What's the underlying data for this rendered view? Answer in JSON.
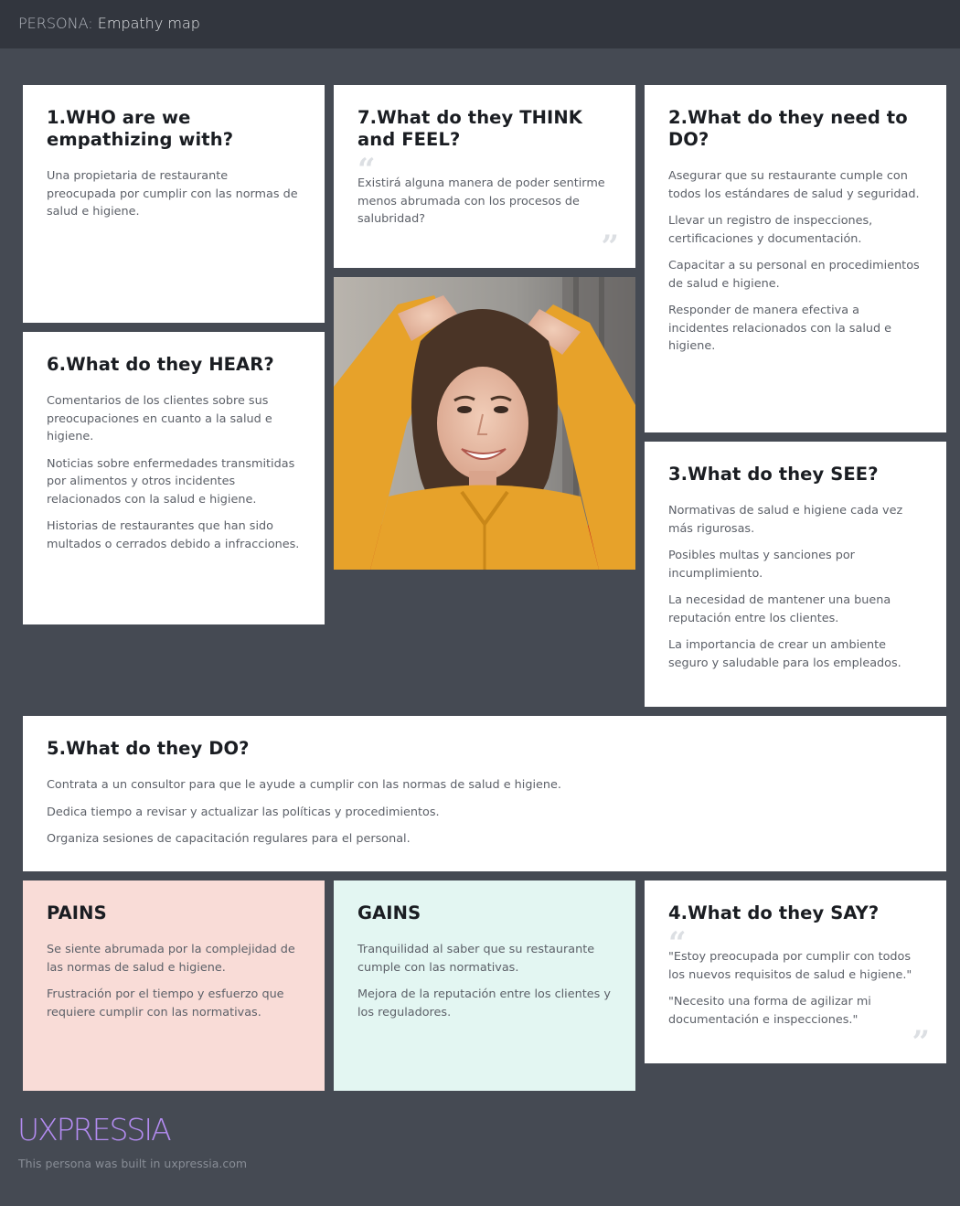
{
  "header": {
    "prefix": "PERSONA:",
    "title": "Empathy map"
  },
  "cards": {
    "who": {
      "title": "1.WHO are we empathizing with?",
      "items": [
        "Una propietaria de restaurante preocupada por cumplir con las normas de salud e higiene."
      ]
    },
    "think_feel": {
      "title": "7.What do they THINK and FEEL?",
      "quotes": [
        "Existirá alguna manera de poder sentirme menos abrumada con los procesos de salubridad?"
      ]
    },
    "need_do": {
      "title": "2.What do they need to DO?",
      "items": [
        "Asegurar que su restaurante cumple con todos los estándares de salud y seguridad.",
        "Llevar un registro de inspecciones, certificaciones y documentación.",
        "Capacitar a su personal en procedimientos de salud e higiene.",
        "Responder de manera efectiva a incidentes relacionados con la salud e higiene."
      ]
    },
    "hear": {
      "title": "6.What do they HEAR?",
      "items": [
        "Comentarios de los clientes sobre sus preocupaciones en cuanto a la salud e higiene.",
        "Noticias sobre enfermedades transmitidas por alimentos y otros incidentes relacionados con la salud e higiene.",
        "Historias de restaurantes que han sido multados o cerrados debido a infracciones."
      ]
    },
    "see": {
      "title": "3.What do they SEE?",
      "items": [
        "Normativas de salud e higiene cada vez más rigurosas.",
        "Posibles multas y sanciones por incumplimiento.",
        "La necesidad de mantener una buena reputación entre los clientes.",
        "La importancia de crear un ambiente seguro y saludable para los empleados."
      ]
    },
    "do": {
      "title": "5.What do they DO?",
      "items": [
        "Contrata a un consultor para que le ayude a cumplir con las normas de salud e higiene.",
        "Dedica tiempo a revisar y actualizar las políticas y procedimientos.",
        "Organiza sesiones de capacitación regulares para el personal."
      ]
    },
    "pains": {
      "title": "PAINS",
      "items": [
        "Se siente abrumada por la complejidad de las normas de salud e higiene.",
        "Frustración por el tiempo y esfuerzo que requiere cumplir con las normativas."
      ]
    },
    "gains": {
      "title": "GAINS",
      "items": [
        "Tranquilidad al saber que su restaurante cumple con las normativas.",
        "Mejora de la reputación entre los clientes y los reguladores."
      ]
    },
    "say": {
      "title": "4.What do they SAY?",
      "quotes": [
        "\"Estoy preocupada por cumplir con todos los nuevos requisitos de salud e higiene.\"",
        "\"Necesito una forma de agilizar mi documentación e inspecciones.\""
      ]
    }
  },
  "quote_open": "“",
  "quote_close": "”",
  "brand": {
    "logo": "UXPRESSIA",
    "note": "This persona was built in uxpressia.com"
  },
  "colors": {
    "background": "#454a53",
    "topbar": "#32363e",
    "pains": "#f9dcd7",
    "gains": "#e3f6f2",
    "logo": "#b48cf2"
  }
}
